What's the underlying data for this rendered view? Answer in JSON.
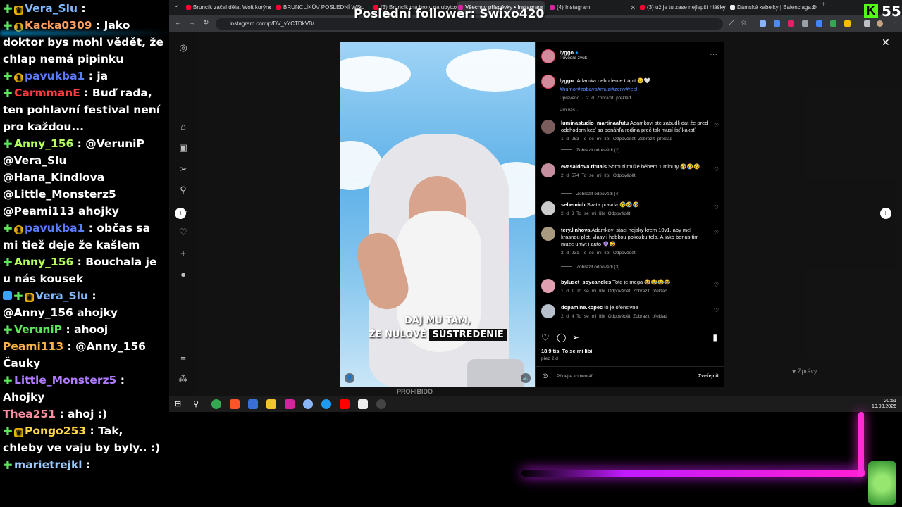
{
  "overlay": {
    "follower_text": "Poslední follower: Swixo420",
    "viewer_count": "55",
    "kick_logo": "K"
  },
  "chat": [
    {
      "user": "Vera_Slu",
      "color": "#7fb8ff",
      "text": "",
      "badges": [
        "plus",
        "crown"
      ]
    },
    {
      "user": "Kacka0309",
      "color": "#ff9f5a",
      "text": "Jako doktor bys mohl vědět, že chlap nemá pipinku",
      "badges": [
        "plus",
        "one"
      ]
    },
    {
      "user": "pavukba1",
      "color": "#5a7dff",
      "text": "ja",
      "badges": [
        "plus",
        "one"
      ]
    },
    {
      "user": "CarmmanE",
      "color": "#ff3b3b",
      "text": "Buď rada, ten pohlavní festival není pro každou...",
      "badges": [
        "plus"
      ]
    },
    {
      "user": "Anny_156",
      "color": "#b4ff5a",
      "text": "@VeruniP @Vera_Slu @Hana_Kindlova @Little_Monsterz5 @Peami113 ahojky",
      "badges": [
        "plus"
      ]
    },
    {
      "user": "pavukba1",
      "color": "#5a7dff",
      "text": "občas sa mi tiež deje že kašlem",
      "badges": [
        "plus",
        "one"
      ]
    },
    {
      "user": "Anny_156",
      "color": "#b4ff5a",
      "text": "Bouchala je u nás kousek",
      "badges": [
        "plus"
      ]
    },
    {
      "user": "Vera_Slu",
      "color": "#7fb8ff",
      "text": "@Anny_156 ahojky",
      "badges": [
        "blue",
        "plus",
        "crown"
      ]
    },
    {
      "user": "VeruniP",
      "color": "#5ce65c",
      "text": "ahooj",
      "badges": [
        "plus"
      ]
    },
    {
      "user": "Peami113",
      "color": "#ffb347",
      "text": "@Anny_156 Čauky",
      "badges": []
    },
    {
      "user": "Little_Monsterz5",
      "color": "#b07bff",
      "text": "Ahojky",
      "badges": [
        "plus"
      ]
    },
    {
      "user": "Thea251",
      "color": "#ff8fa0",
      "text": "ahoj :)",
      "badges": []
    },
    {
      "user": "Pongo253",
      "color": "#ffd54a",
      "text": "Tak, chleby ve vaju by byly.. :)",
      "badges": [
        "plus",
        "crown"
      ]
    },
    {
      "user": "marietrejkl",
      "color": "#9ecbff",
      "text": "",
      "badges": [
        "plus"
      ]
    }
  ],
  "tabs": [
    {
      "label": "Bruncík začal dělat Wolt kurýra",
      "active": false
    },
    {
      "label": "BRUNCLÍKŮV POSLEDNÍ WOLT",
      "active": false
    },
    {
      "label": "(3) Bruncík má hroty na ubyto",
      "active": false
    },
    {
      "label": "Všechny příspěvky • Instagram",
      "active": true
    },
    {
      "label": "(4) Instagram",
      "active": false
    },
    {
      "label": "(3) už je tu zase nejlepší hlášky",
      "active": false
    },
    {
      "label": "Dámské kabelky | Balenciaga D",
      "active": false
    }
  ],
  "address": {
    "url": "instagram.com/p/DV_vYCTDkVB/"
  },
  "video": {
    "subtitle_line1": "DAJ MU TAM,",
    "subtitle_line2_a": "ŽE NULOVÉ",
    "subtitle_line2_b": "SÚSTREDENIE"
  },
  "post": {
    "author": "lyggo",
    "audio": "Původní zvuk",
    "caption_text": "Adamka nebudeme trápit 😉🤍",
    "hashtags": "#humor#zabava#muzi#zeny#reel",
    "caption_meta": "Upraveno · 2 d",
    "translate": "Zobrazit překlad",
    "filter": "Pro vás",
    "likes": "18,9 tis. To se mi líbí",
    "posted": "před 2 d",
    "comment_placeholder": "Přidejte komentář…",
    "publish": "Zveřejnit"
  },
  "comments": [
    {
      "user": "luminastudio_martinaafutu",
      "text": "Adamkovi ste zabudli dat že pred odchodom keď sa ponáhľa rodina preč tak musí ísť kakať.",
      "meta": "1 d   253 To se mi líbí   Odpovědět   Zobrazit překlad",
      "replies": "Zobrazit odpovědi (2)"
    },
    {
      "user": "evasaldova.rituals",
      "text": "Shrnutí muže během 1 minuty 🤣🤣🤣",
      "meta": "2 d   574 To se mi líbí   Odpovědět",
      "replies": "Zobrazit odpovědi (4)"
    },
    {
      "user": "sebemich",
      "text": "Svata pravda 🤣🤣🤣",
      "meta": "2 d   3 To se mi líbí   Odpovědět",
      "replies": ""
    },
    {
      "user": "tery.linhova",
      "text": "Adamkovi staci nejaky krem 10v1, aby mel krasnou plet, vlasy i hebkou pokozku tela. A jako bonus tim muze umyt i auto 🔮🤣",
      "meta": "2 d   231 To se mi líbí   Odpovědět",
      "replies": "Zobrazit odpovědi (3)"
    },
    {
      "user": "byluset_soycandles",
      "text": "Toto je mega 😂😂😂😂",
      "meta": "1 d   1 To se mi líbí   Odpovědět   Zobrazit překlad",
      "replies": ""
    },
    {
      "user": "dopamine.kopec",
      "text": "to je ofensivne",
      "meta": "2 d   4 To se mi líbí   Odpovědět   Zobrazit překlad",
      "replies": ""
    }
  ],
  "messages_label": "Zprávy",
  "taskbar": {
    "time": "20:51",
    "date": "19.03.2026"
  },
  "bottom_caption": "PROHIBIDO"
}
